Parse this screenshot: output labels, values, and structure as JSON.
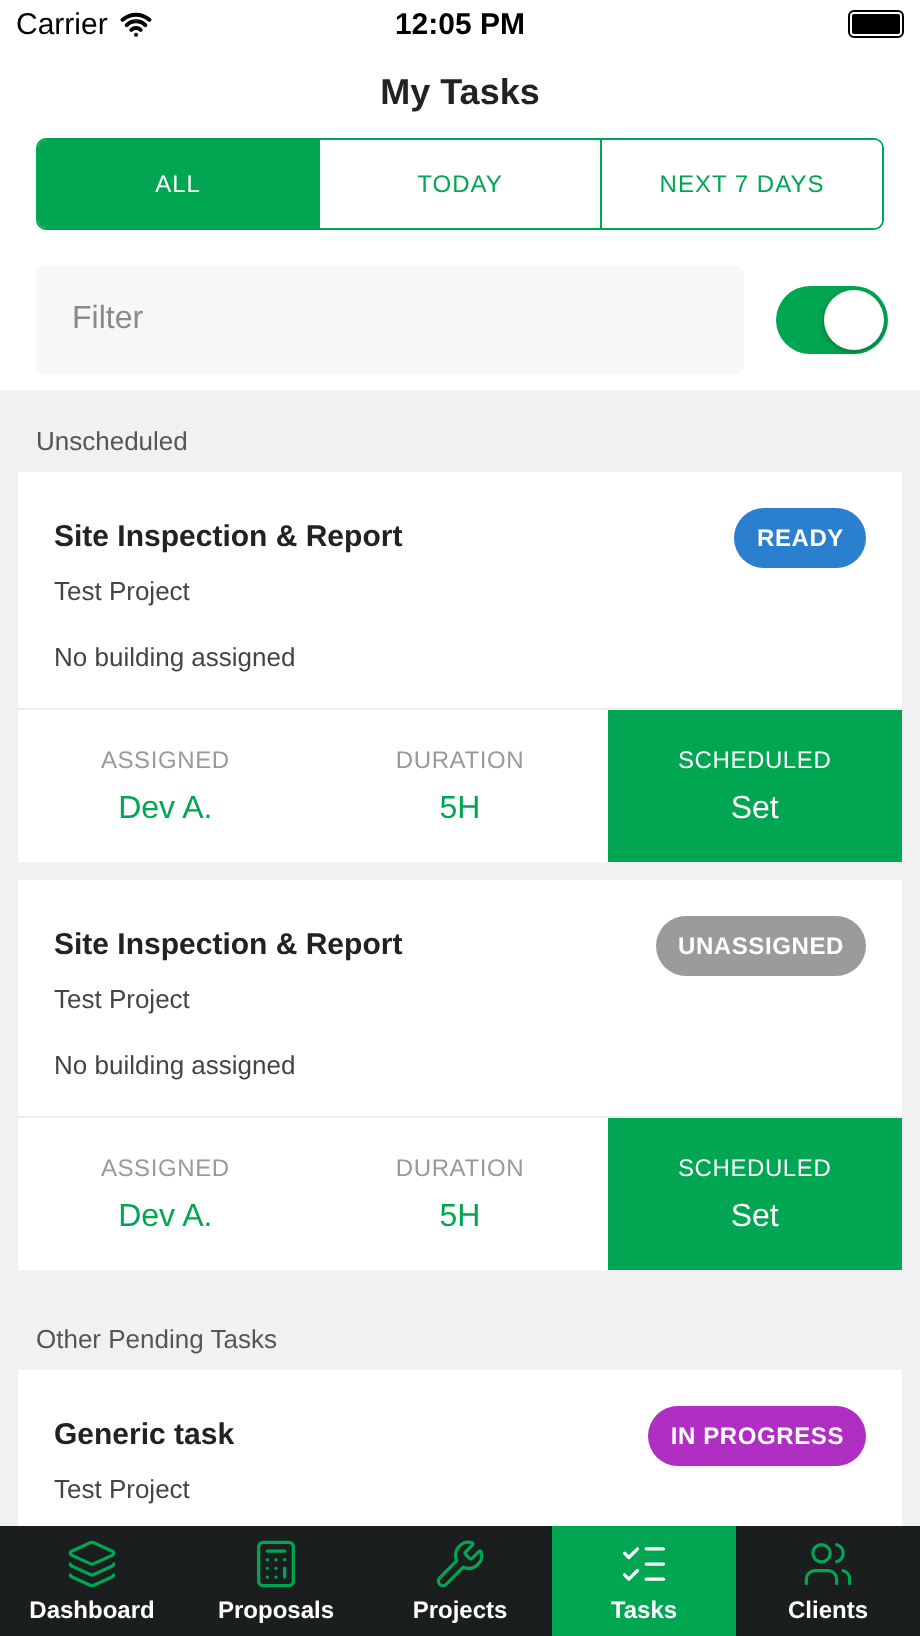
{
  "status_bar": {
    "carrier": "Carrier",
    "time": "12:05 PM"
  },
  "title": "My Tasks",
  "tabs": [
    {
      "label": "ALL",
      "selected": true
    },
    {
      "label": "TODAY",
      "selected": false
    },
    {
      "label": "NEXT 7 DAYS",
      "selected": false
    }
  ],
  "filter": {
    "placeholder": "Filter",
    "toggle_on": true
  },
  "sections": [
    {
      "heading": "Unscheduled",
      "tasks": [
        {
          "title": "Site Inspection & Report",
          "project": "Test Project",
          "building": "No building assigned",
          "status": "READY",
          "color": "#2a7fcf",
          "stats": [
            {
              "label": "ASSIGNED",
              "value": "Dev A.",
              "highlighted": false
            },
            {
              "label": "DURATION",
              "value": "5H",
              "highlighted": false
            },
            {
              "label": "SCHEDULED",
              "value": "Set",
              "highlighted": true
            }
          ]
        },
        {
          "title": "Site Inspection & Report",
          "project": "Test Project",
          "building": "No building assigned",
          "status": "UNASSIGNED",
          "color": "#9b9b9b",
          "stats": [
            {
              "label": "ASSIGNED",
              "value": "Dev A.",
              "highlighted": false
            },
            {
              "label": "DURATION",
              "value": "5H",
              "highlighted": false
            },
            {
              "label": "SCHEDULED",
              "value": "Set",
              "highlighted": true
            }
          ]
        }
      ]
    },
    {
      "heading": "Other Pending Tasks",
      "tasks": [
        {
          "title": "Generic task",
          "project": "Test Project",
          "status": "IN PROGRESS",
          "color": "#b02ec4"
        }
      ]
    }
  ],
  "nav": [
    {
      "kind": "layers",
      "label": "Dashboard",
      "selected": false
    },
    {
      "kind": "calculator",
      "label": "Proposals",
      "selected": false
    },
    {
      "kind": "wrench",
      "label": "Projects",
      "selected": false
    },
    {
      "kind": "list",
      "label": "Tasks",
      "selected": true
    },
    {
      "kind": "users",
      "label": "Clients",
      "selected": false
    }
  ]
}
